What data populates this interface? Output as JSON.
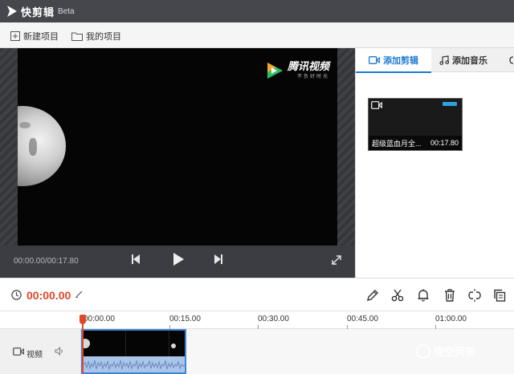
{
  "app": {
    "name": "快剪辑",
    "tag": "Beta"
  },
  "toolbar": {
    "new_project": "新建项目",
    "my_projects": "我的项目"
  },
  "preview": {
    "timecode": "00:00.00/00:17.80",
    "watermark_title": "腾讯视频",
    "watermark_sub": "不负好时光"
  },
  "panel": {
    "tabs": [
      {
        "label": "添加剪辑",
        "icon": "video-camera-icon",
        "active": true
      },
      {
        "label": "添加音乐",
        "icon": "music-note-icon",
        "active": false
      }
    ],
    "clip": {
      "title": "超级蓝血月全...",
      "duration": "00:17.80"
    }
  },
  "editbar": {
    "current_time": "00:00.00"
  },
  "timeline": {
    "ruler": [
      "00:00.00",
      "00:15.00",
      "00:30.00",
      "00:45.00",
      "01:00.00"
    ],
    "track_label": "视频"
  },
  "corner_watermark": "悟空问答",
  "colors": {
    "accent": "#1e7ad0",
    "time_red": "#e0472a",
    "titlebar": "#45474d"
  }
}
